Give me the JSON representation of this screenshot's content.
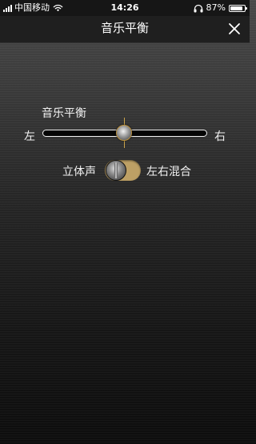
{
  "status_bar": {
    "carrier": "中国移动",
    "time": "14:26",
    "battery_text": "87%",
    "battery_level": 0.87,
    "icons": [
      "signal-icon",
      "wifi-icon",
      "headphone-icon",
      "battery-icon"
    ]
  },
  "nav": {
    "title": "音乐平衡",
    "close_icon": "close-icon"
  },
  "balance": {
    "label": "音乐平衡",
    "left_label": "左",
    "right_label": "右",
    "value": 0.5
  },
  "stereo_toggle": {
    "off_label": "立体声",
    "on_label": "左右混合",
    "state": "off"
  },
  "colors": {
    "accent": "#bda065",
    "thumb_ring": "#b98f3e",
    "nav_background": "#1f1f1f"
  }
}
